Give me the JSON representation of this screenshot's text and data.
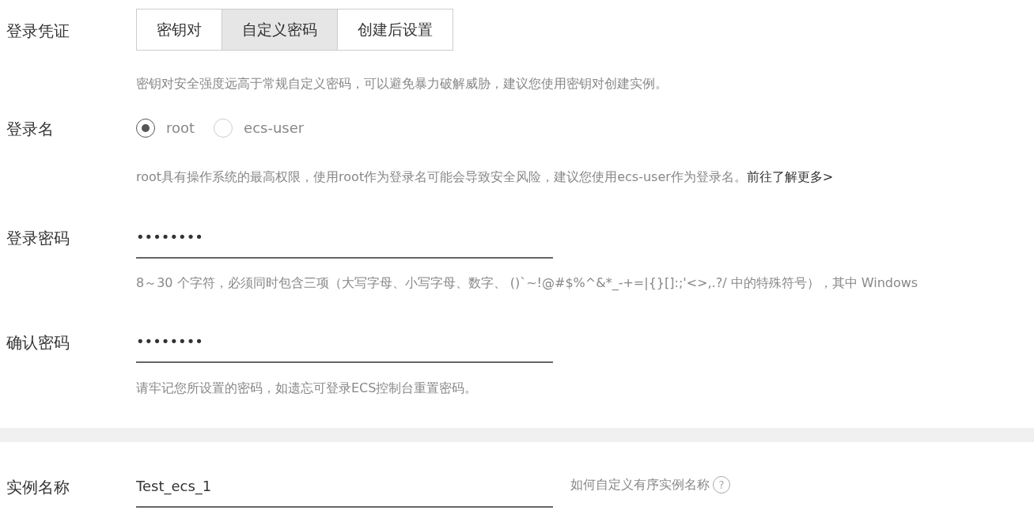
{
  "credential": {
    "label": "登录凭证",
    "tabs": [
      {
        "label": "密钥对",
        "selected": false
      },
      {
        "label": "自定义密码",
        "selected": true
      },
      {
        "label": "创建后设置",
        "selected": false
      }
    ],
    "hint": "密钥对安全强度远高于常规自定义密码，可以避免暴力破解威胁，建议您使用密钥对创建实例。"
  },
  "login_name": {
    "label": "登录名",
    "options": [
      {
        "label": "root",
        "selected": true
      },
      {
        "label": "ecs-user",
        "selected": false
      }
    ],
    "hint": "root具有操作系统的最高权限，使用root作为登录名可能会导致安全风险，建议您使用ecs-user作为登录名。",
    "link": "前往了解更多>"
  },
  "password": {
    "label": "登录密码",
    "value": "••••••••",
    "hint": "8～30 个字符，必须同时包含三项（大写字母、小写字母、数字、 ()`~!@#$%^&*_-+=|{}[]:;'<>,.?/ 中的特殊符号），其中 Windows"
  },
  "confirm": {
    "label": "确认密码",
    "value": "••••••••",
    "hint": "请牢记您所设置的密码，如遗忘可登录ECS控制台重置密码。"
  },
  "instance": {
    "label": "实例名称",
    "value": "Test_ecs_1",
    "help": "如何自定义有序实例名称",
    "help_icon": "?"
  }
}
